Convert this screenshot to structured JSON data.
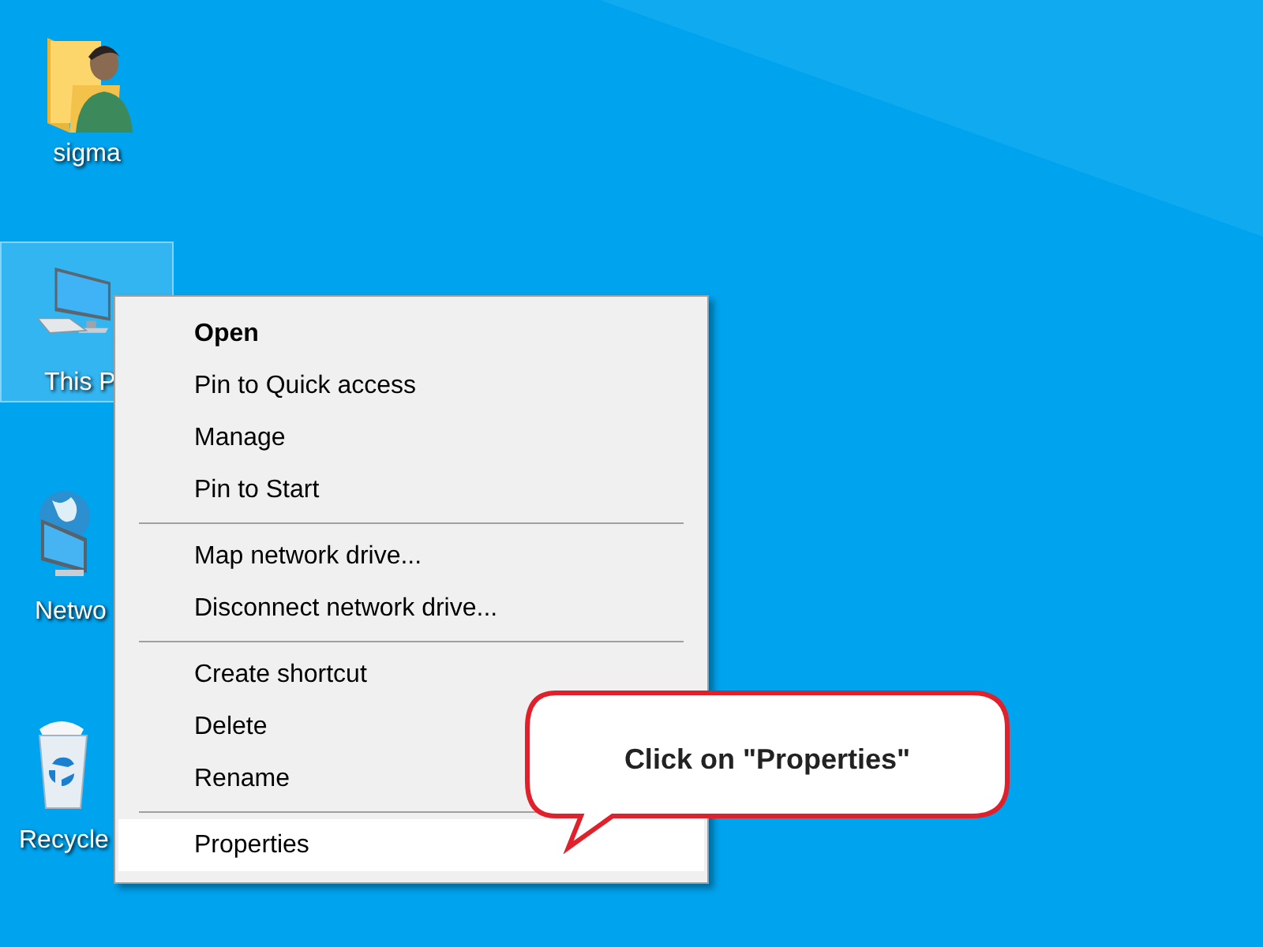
{
  "desktop_icons": [
    {
      "kind": "user-folder",
      "label": "sigma",
      "selected": false
    },
    {
      "kind": "computer",
      "label": "This P",
      "selected": true
    },
    {
      "kind": "network",
      "label": "Netwo",
      "selected": false
    },
    {
      "kind": "recycle-bin",
      "label": "Recycle",
      "selected": false
    }
  ],
  "context_menu": {
    "items": [
      {
        "kind": "item",
        "label": "Open",
        "default": true,
        "selected": false
      },
      {
        "kind": "item",
        "label": "Pin to Quick access",
        "default": false,
        "selected": false
      },
      {
        "kind": "item",
        "label": "Manage",
        "default": false,
        "selected": false
      },
      {
        "kind": "item",
        "label": "Pin to Start",
        "default": false,
        "selected": false
      },
      {
        "kind": "separator"
      },
      {
        "kind": "item",
        "label": "Map network drive...",
        "default": false,
        "selected": false
      },
      {
        "kind": "item",
        "label": "Disconnect network drive...",
        "default": false,
        "selected": false
      },
      {
        "kind": "separator"
      },
      {
        "kind": "item",
        "label": "Create shortcut",
        "default": false,
        "selected": false
      },
      {
        "kind": "item",
        "label": "Delete",
        "default": false,
        "selected": false
      },
      {
        "kind": "item",
        "label": "Rename",
        "default": false,
        "selected": false
      },
      {
        "kind": "separator"
      },
      {
        "kind": "item",
        "label": "Properties",
        "default": false,
        "selected": true
      }
    ]
  },
  "callout": {
    "text": "Click on \"Properties\""
  }
}
